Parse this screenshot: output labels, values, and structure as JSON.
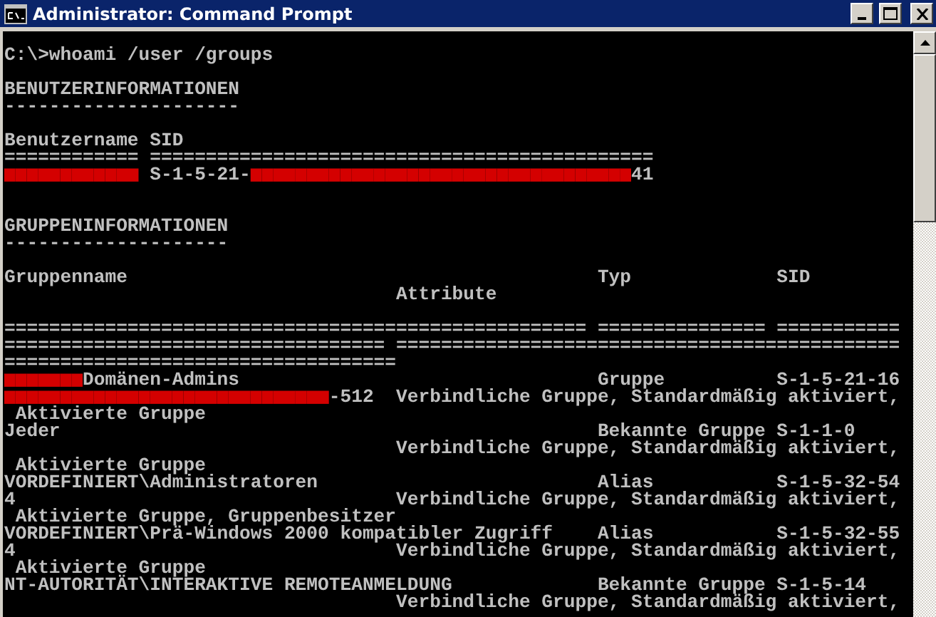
{
  "window": {
    "title": "Administrator: Command Prompt"
  },
  "console": {
    "lines": [
      {
        "kind": "output",
        "segments": [
          {
            "kind": "text",
            "text": "C:\\>whoami /user /groups"
          }
        ]
      },
      {
        "kind": "blank"
      },
      {
        "kind": "output",
        "segments": [
          {
            "kind": "text",
            "text": "BENUTZERINFORMATIONEN"
          }
        ]
      },
      {
        "kind": "output",
        "segments": [
          {
            "kind": "text",
            "text": "---------------------"
          }
        ]
      },
      {
        "kind": "blank"
      },
      {
        "kind": "output",
        "segments": [
          {
            "kind": "text",
            "text": "Benutzername SID"
          }
        ]
      },
      {
        "kind": "output",
        "segments": [
          {
            "kind": "text",
            "text": "============ ============================================="
          }
        ]
      },
      {
        "kind": "output",
        "segments": [
          {
            "kind": "redaction",
            "text": "████████████"
          },
          {
            "kind": "text",
            "text": " S-1-5-21-"
          },
          {
            "kind": "redaction",
            "text": "██████████████████████████████████"
          },
          {
            "kind": "text",
            "text": "41"
          }
        ]
      },
      {
        "kind": "blank"
      },
      {
        "kind": "blank"
      },
      {
        "kind": "output",
        "segments": [
          {
            "kind": "text",
            "text": "GRUPPENINFORMATIONEN"
          }
        ]
      },
      {
        "kind": "output",
        "segments": [
          {
            "kind": "text",
            "text": "--------------------"
          }
        ]
      },
      {
        "kind": "blank"
      },
      {
        "kind": "output",
        "segments": [
          {
            "kind": "text",
            "text": "Gruppenname                                          Typ             SID"
          }
        ]
      },
      {
        "kind": "output",
        "segments": [
          {
            "kind": "text",
            "text": "                                   Attribute"
          }
        ]
      },
      {
        "kind": "blank"
      },
      {
        "kind": "output",
        "segments": [
          {
            "kind": "text",
            "text": "==================================================== =============== ==========="
          }
        ]
      },
      {
        "kind": "output",
        "segments": [
          {
            "kind": "text",
            "text": "================================== ============================================="
          }
        ]
      },
      {
        "kind": "output",
        "segments": [
          {
            "kind": "text",
            "text": "==================================="
          }
        ]
      },
      {
        "kind": "output",
        "segments": [
          {
            "kind": "redaction",
            "text": "███████"
          },
          {
            "kind": "text",
            "text": "Domänen-Admins                                Gruppe          S-1-5-21-16"
          }
        ]
      },
      {
        "kind": "output",
        "segments": [
          {
            "kind": "redaction",
            "text": "█████████████████████████████"
          },
          {
            "kind": "text",
            "text": "-512  Verbindliche Gruppe, Standardmäßig aktiviert,"
          }
        ]
      },
      {
        "kind": "output",
        "segments": [
          {
            "kind": "text",
            "text": " Aktivierte Gruppe"
          }
        ]
      },
      {
        "kind": "output",
        "segments": [
          {
            "kind": "text",
            "text": "Jeder                                                Bekannte Gruppe S-1-1-0"
          }
        ]
      },
      {
        "kind": "output",
        "segments": [
          {
            "kind": "text",
            "text": "                                   Verbindliche Gruppe, Standardmäßig aktiviert,"
          }
        ]
      },
      {
        "kind": "output",
        "segments": [
          {
            "kind": "text",
            "text": " Aktivierte Gruppe"
          }
        ]
      },
      {
        "kind": "output",
        "segments": [
          {
            "kind": "text",
            "text": "VORDEFINIERT\\Administratoren                         Alias           S-1-5-32-54"
          }
        ]
      },
      {
        "kind": "output",
        "segments": [
          {
            "kind": "text",
            "text": "4                                  Verbindliche Gruppe, Standardmäßig aktiviert,"
          }
        ]
      },
      {
        "kind": "output",
        "segments": [
          {
            "kind": "text",
            "text": " Aktivierte Gruppe, Gruppenbesitzer"
          }
        ]
      },
      {
        "kind": "output",
        "segments": [
          {
            "kind": "text",
            "text": "VORDEFINIERT\\Prä-Windows 2000 kompatibler Zugriff    Alias           S-1-5-32-55"
          }
        ]
      },
      {
        "kind": "output",
        "segments": [
          {
            "kind": "text",
            "text": "4                                  Verbindliche Gruppe, Standardmäßig aktiviert,"
          }
        ]
      },
      {
        "kind": "output",
        "segments": [
          {
            "kind": "text",
            "text": " Aktivierte Gruppe"
          }
        ]
      },
      {
        "kind": "output",
        "segments": [
          {
            "kind": "text",
            "text": "NT-AUTORITÄT\\INTERAKTIVE REMOTEANMELDUNG             Bekannte Gruppe S-1-5-14"
          }
        ]
      },
      {
        "kind": "output",
        "segments": [
          {
            "kind": "text",
            "text": "                                   Verbindliche Gruppe, Standardmäßig aktiviert,"
          }
        ]
      }
    ]
  }
}
